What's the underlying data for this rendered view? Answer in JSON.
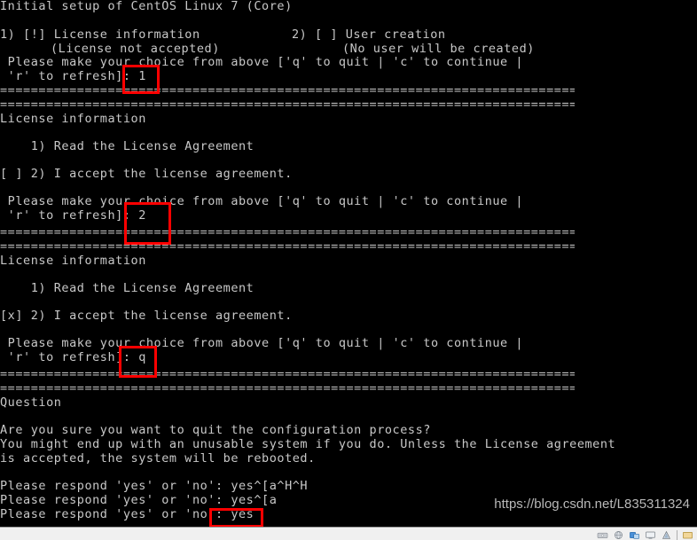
{
  "terminal": {
    "title_line": "Initial setup of CentOS Linux 7 (Core)",
    "screen1": {
      "item1": "1) [!] License information",
      "item1_sub": "(License not accepted)",
      "item2": "2) [ ] User creation",
      "item2_sub": "(No user will be created)",
      "prompt_line1": " Please make your choice from above ['q' to quit | 'c' to continue |",
      "prompt_line2": " 'r' to refresh]: 1",
      "entered_value": "1",
      "separator": "================================================================================"
    },
    "screen2": {
      "header": "License information",
      "item1": "    1) Read the License Agreement",
      "item2": "[ ] 2) I accept the license agreement.",
      "prompt_line1": " Please make your choice from above ['q' to quit | 'c' to continue |",
      "prompt_line2": " 'r' to refresh]: 2",
      "entered_value": "2",
      "separator": "================================================================================"
    },
    "screen3": {
      "header": "License information",
      "item1": "    1) Read the License Agreement",
      "item2": "[x] 2) I accept the license agreement.",
      "prompt_line1": " Please make your choice from above ['q' to quit | 'c' to continue |",
      "prompt_line2": " 'r' to refresh]: q",
      "entered_value": "q",
      "separator": "================================================================================"
    },
    "question": {
      "header": "Question",
      "body_line1": "Are you sure you want to quit the configuration process?",
      "body_line2": "You might end up with an unusable system if you do. Unless the License agreement",
      "body_line3": "is accepted, the system will be rebooted.",
      "respond_line1": "Please respond 'yes' or 'no': yes^[a^H^H",
      "respond_line2": "Please respond 'yes' or 'no': yes^[a",
      "respond_line3": "Please respond 'yes' or 'no': yes",
      "entered_value": "yes"
    }
  },
  "watermark": {
    "text": "https://blog.csdn.net/L835311324"
  },
  "statusbar": {
    "left_text": "",
    "icons": [
      "disc-icon",
      "network-icon",
      "usb-icon",
      "display-icon",
      "printer-icon",
      "folder-icon"
    ]
  },
  "colors": {
    "background": "#000000",
    "terminal_text": "#c8c8c8",
    "highlight_box": "#fe0000",
    "statusbar_bg": "#f0f0f0"
  }
}
